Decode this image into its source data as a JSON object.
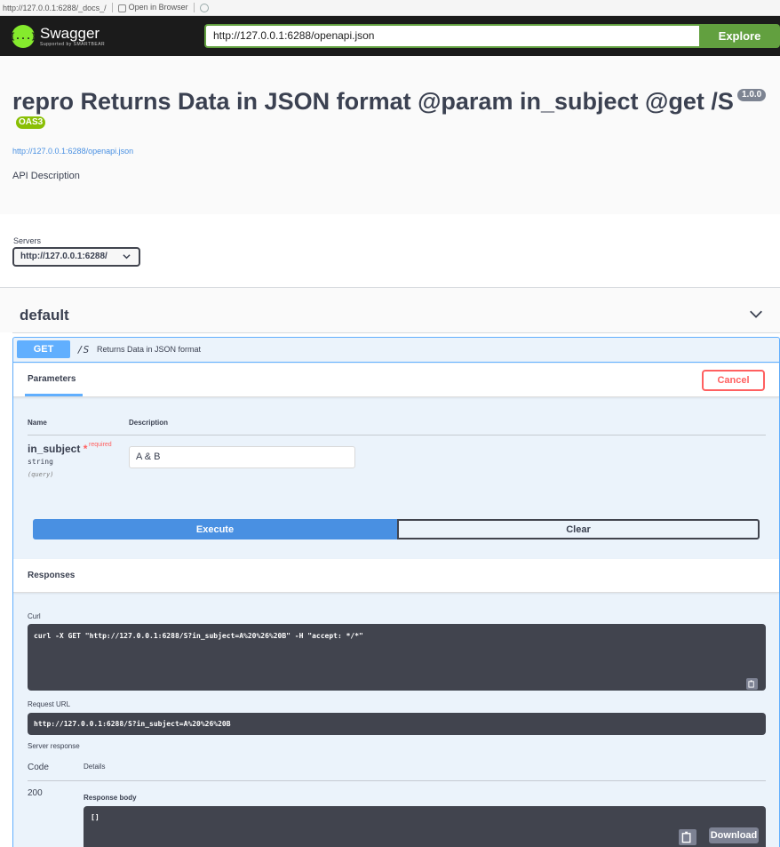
{
  "browser": {
    "address": "http://127.0.0.1:6288/_docs_/",
    "open_in_browser": "Open in Browser"
  },
  "topbar": {
    "logo_title": "Swagger",
    "logo_sub": "Supported by SMARTBEAR",
    "logo_glyph": "{...}",
    "spec_url": "http://127.0.0.1:6288/openapi.json",
    "explore_label": "Explore",
    "accent_color": "#62a03f"
  },
  "info": {
    "title": "repro Returns Data in JSON format @param in_subject @get /S",
    "version": "1.0.0",
    "oas_badge": "OAS3",
    "spec_link": "http://127.0.0.1:6288/openapi.json",
    "description": "API Description"
  },
  "servers": {
    "label": "Servers",
    "selected": "http://127.0.0.1:6288/"
  },
  "tag": {
    "name": "default",
    "icon": "chevron-down-icon"
  },
  "operation": {
    "method": "GET",
    "path": "/S",
    "summary": "Returns Data in JSON format",
    "method_color": "#61affe",
    "parameters_tab": "Parameters",
    "cancel_label": "Cancel",
    "columns": {
      "name": "Name",
      "description": "Description"
    },
    "param": {
      "name": "in_subject",
      "required_star": "*",
      "required_label": "required",
      "type": "string",
      "location": "(query)",
      "value": "A & B"
    },
    "execute_label": "Execute",
    "clear_label": "Clear"
  },
  "responses": {
    "title": "Responses",
    "curl_label": "Curl",
    "curl": "curl -X GET \"http://127.0.0.1:6288/S?in_subject=A%20%26%20B\" -H \"accept: */*\"",
    "request_url_label": "Request URL",
    "request_url": "http://127.0.0.1:6288/S?in_subject=A%20%26%20B",
    "server_response_label": "Server response",
    "code_header": "Code",
    "details_header": "Details",
    "code": "200",
    "response_body_label": "Response body",
    "response_body": "[]",
    "download_label": "Download"
  }
}
